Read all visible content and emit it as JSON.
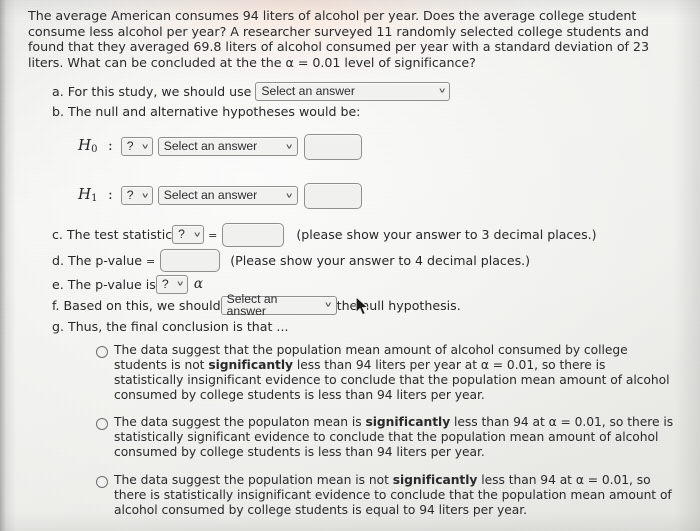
{
  "problem": {
    "statement": "The average American consumes 94 liters of alcohol per year. Does the average college student consume less alcohol per year? A researcher surveyed 11 randomly selected college students and found that they averaged 69.8 liters of alcohol consumed per year with a standard deviation of 23 liters. What can be concluded at the the α = 0.01 level of significance?",
    "population_mean": "94",
    "sample_size": "11",
    "sample_mean": "69.8",
    "standard_deviation": "23",
    "alpha": "0.01"
  },
  "steps": {
    "a": {
      "prefix": "a. For this study, we should use ",
      "dropdown_value": "Select an answer"
    },
    "b": {
      "prefix": "b. The null and alternative hypotheses would be:",
      "null_hypothesis": {
        "symbol": "H",
        "subscript": "0",
        "colon": ":",
        "operator_dropdown": "?",
        "parameter_dropdown": "Select an answer",
        "value_input": ""
      },
      "alt_hypothesis": {
        "symbol": "H",
        "subscript": "1",
        "colon": ":",
        "operator_dropdown": "?",
        "parameter_dropdown": "Select an answer",
        "value_input": ""
      }
    },
    "c": {
      "prefix": "c. The test statistic ",
      "statistic_dropdown": "?",
      "equals": "=",
      "value_input": "",
      "suffix": "(please show your answer to 3 decimal places.)"
    },
    "d": {
      "prefix": "d. The p-value ",
      "equals": "=",
      "value_input": "",
      "suffix": "(Please show your answer to 4 decimal places.)"
    },
    "e": {
      "prefix": "e. The p-value is ",
      "comparison_dropdown": "?",
      "alpha_symbol": "α"
    },
    "f": {
      "prefix": "f. Based on this, we should ",
      "dropdown_value": "Select an answer",
      "suffix": " the null hypothesis."
    },
    "g": {
      "prefix": "g. Thus, the final conclusion is that ..."
    }
  },
  "options": [
    {
      "id": "option-1",
      "selected": false,
      "parts": [
        {
          "text": "The data suggest that the population mean amount of alcohol consumed by college students is not ",
          "bold": false
        },
        {
          "text": "significantly",
          "bold": true
        },
        {
          "text": " less than 94 liters per year at α = 0.01, so there is statistically insignificant evidence to conclude that the population mean amount of alcohol consumed by college students is less than 94 liters per year.",
          "bold": false
        }
      ]
    },
    {
      "id": "option-2",
      "selected": false,
      "parts": [
        {
          "text": "The data suggest the populaton mean is ",
          "bold": false
        },
        {
          "text": "significantly",
          "bold": true
        },
        {
          "text": " less than 94 at α = 0.01, so there is statistically significant evidence to conclude that the population mean amount of alcohol consumed by college students is less than 94 liters per year.",
          "bold": false
        }
      ]
    },
    {
      "id": "option-3",
      "selected": false,
      "parts": [
        {
          "text": "The data suggest the population mean is not ",
          "bold": false
        },
        {
          "text": "significantly",
          "bold": true
        },
        {
          "text": " less than 94 at α = 0.01, so there is statistically insignificant evidence to conclude that the population mean amount of alcohol consumed by college students is equal to 94 liters per year.",
          "bold": false
        }
      ]
    }
  ],
  "ui": {
    "chevron_glyph": "∨",
    "page_background": "#f0f0ed",
    "text_color": "#2a2a2d",
    "control_border_color": "#8f8f8d",
    "control_fill_color": "#f1f1ef"
  }
}
